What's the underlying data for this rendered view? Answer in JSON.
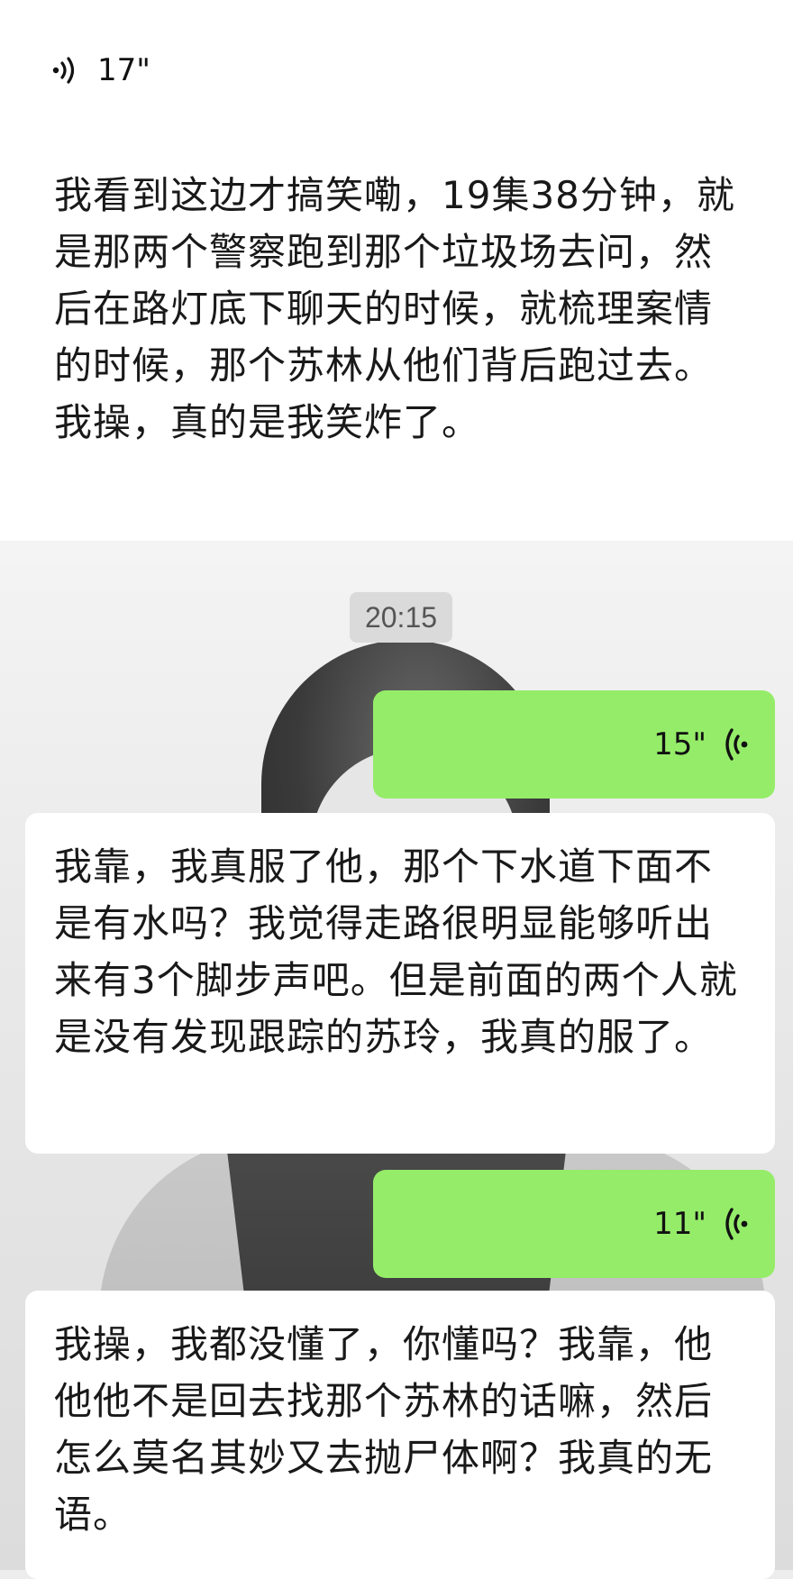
{
  "message1": {
    "voice_icon": "voice-wave-icon",
    "duration": "17\"",
    "transcript": "我看到这边才搞笑嘞，19集38分钟，就是那两个警察跑到那个垃圾场去问，然后在路灯底下聊天的时候，就梳理案情的时候，那个苏林从他们背后跑过去。我操，真的是我笑炸了。"
  },
  "timestamp": "20:15",
  "message2": {
    "voice_icon": "voice-wave-icon",
    "duration": "15\"",
    "transcript": "我靠，我真服了他，那个下水道下面不是有水吗？我觉得走路很明显能够听出来有3个脚步声吧。但是前面的两个人就是没有发现跟踪的苏玲，我真的服了。"
  },
  "message3": {
    "voice_icon": "voice-wave-icon",
    "duration": "11\"",
    "transcript": "我操，我都没懂了，你懂吗？我靠，他他他不是回去找那个苏林的话嘛，然后怎么莫名其妙又去抛尸体啊？我真的无语。"
  },
  "colors": {
    "outgoing_bubble": "#95ec69",
    "incoming_card": "#ffffff",
    "timestamp_bg": "#dadada"
  }
}
